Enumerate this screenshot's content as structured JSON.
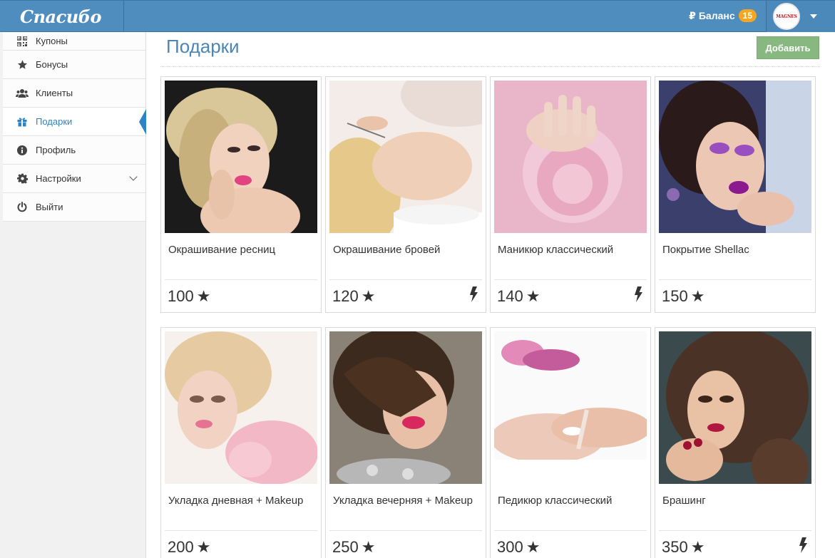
{
  "brand": {
    "name": "Спасибо"
  },
  "navbar": {
    "balance_icon": "₽",
    "balance_label": "Баланс",
    "balance_count": "15",
    "avatar_text": "MAGNES",
    "avatar_menu_icon": "chevron-down-icon"
  },
  "sidebar": {
    "items": [
      {
        "label": "Купоны",
        "icon": "qr-code-icon"
      },
      {
        "label": "Бонусы",
        "icon": "star-icon"
      },
      {
        "label": "Клиенты",
        "icon": "users-icon"
      },
      {
        "label": "Подарки",
        "icon": "gift-icon",
        "active": true
      },
      {
        "label": "Профиль",
        "icon": "info-icon"
      },
      {
        "label": "Настройки",
        "icon": "gear-icon",
        "has_submenu": true
      },
      {
        "label": "Выйти",
        "icon": "power-icon"
      }
    ]
  },
  "main": {
    "title": "Подарки",
    "add_label": "Добавить"
  },
  "gifts": [
    {
      "name": "Окрашивание ресниц",
      "points": "100",
      "instant": false
    },
    {
      "name": "Окрашивание бровей",
      "points": "120",
      "instant": true
    },
    {
      "name": "Маникюр классический",
      "points": "140",
      "instant": true
    },
    {
      "name": "Покрытие Shellac",
      "points": "150",
      "instant": false
    },
    {
      "name": "Укладка дневная + Makeup",
      "points": "200",
      "instant": false
    },
    {
      "name": "Укладка вечерняя + Makeup",
      "points": "250",
      "instant": false
    },
    {
      "name": "Педикюр классический",
      "points": "300",
      "instant": false
    },
    {
      "name": "Брашинг",
      "points": "350",
      "instant": true
    }
  ],
  "colors": {
    "navbar": "#4f8dbf",
    "accent": "#2c84c6",
    "add_button": "#87b87f",
    "badge": "#f5a623"
  }
}
